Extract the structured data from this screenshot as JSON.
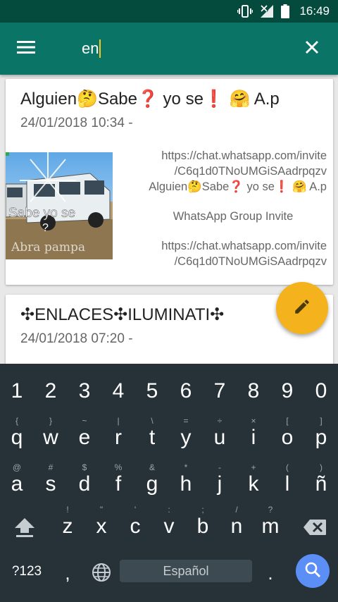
{
  "status_bar": {
    "time": "16:49",
    "icons": [
      "vibrate-icon",
      "signal-off-icon",
      "battery-icon"
    ]
  },
  "app_bar": {
    "menu_icon": "hamburger-menu-icon",
    "search_value": "en",
    "close_icon": "close-icon",
    "color": "#0a7466"
  },
  "cards": [
    {
      "title": "Alguien🤔Sabe❓ yo se❗ 🤗 A.p",
      "date": "24/01/2018 10:34 -",
      "thumbnail": {
        "overlay_text": "Sabe yo se",
        "overlay_text2": "?",
        "watermark": "Abra pampa"
      },
      "preview": {
        "url_line1": "https://chat.whatsapp.com/invite",
        "url_line2": "/C6q1d0TNoUMGiSAadrpqzv",
        "name": "Alguien🤔Sabe❓ yo se❗ 🤗 A.p",
        "type": "WhatsApp Group Invite",
        "url2_line1": "https://chat.whatsapp.com/invite",
        "url2_line2": "/C6q1d0TNoUMGiSAadrpqzv"
      }
    },
    {
      "title": "✣ENLACES✣ILUMINATI✣",
      "date": "24/01/2018 07:20 -"
    }
  ],
  "fab": {
    "icon": "pencil-icon",
    "color": "#f4b31d"
  },
  "keyboard": {
    "numbers": [
      "1",
      "2",
      "3",
      "4",
      "5",
      "6",
      "7",
      "8",
      "9",
      "0"
    ],
    "row1": {
      "keys": [
        "q",
        "w",
        "e",
        "r",
        "t",
        "y",
        "u",
        "i",
        "o",
        "p"
      ],
      "hints": [
        "{",
        "}",
        "~",
        "|",
        "\\",
        "=",
        "÷",
        "×",
        "[",
        "]"
      ]
    },
    "row2": {
      "keys": [
        "a",
        "s",
        "d",
        "f",
        "g",
        "h",
        "j",
        "k",
        "l",
        "ñ"
      ],
      "hints": [
        "@",
        "#",
        "$",
        "%",
        "&",
        "*",
        "-",
        "+",
        "(",
        ")"
      ]
    },
    "row3": {
      "keys": [
        "z",
        "x",
        "c",
        "v",
        "b",
        "n",
        "m"
      ],
      "hints": [
        "!",
        "\"",
        "'",
        ":",
        ";",
        "/",
        "?"
      ]
    },
    "symbols_key": "?123",
    "comma": ",",
    "period": ".",
    "space_label": "Español",
    "shift_icon": "shift-icon",
    "backspace_icon": "backspace-icon",
    "globe_icon": "globe-icon",
    "search_icon": "search-icon"
  }
}
